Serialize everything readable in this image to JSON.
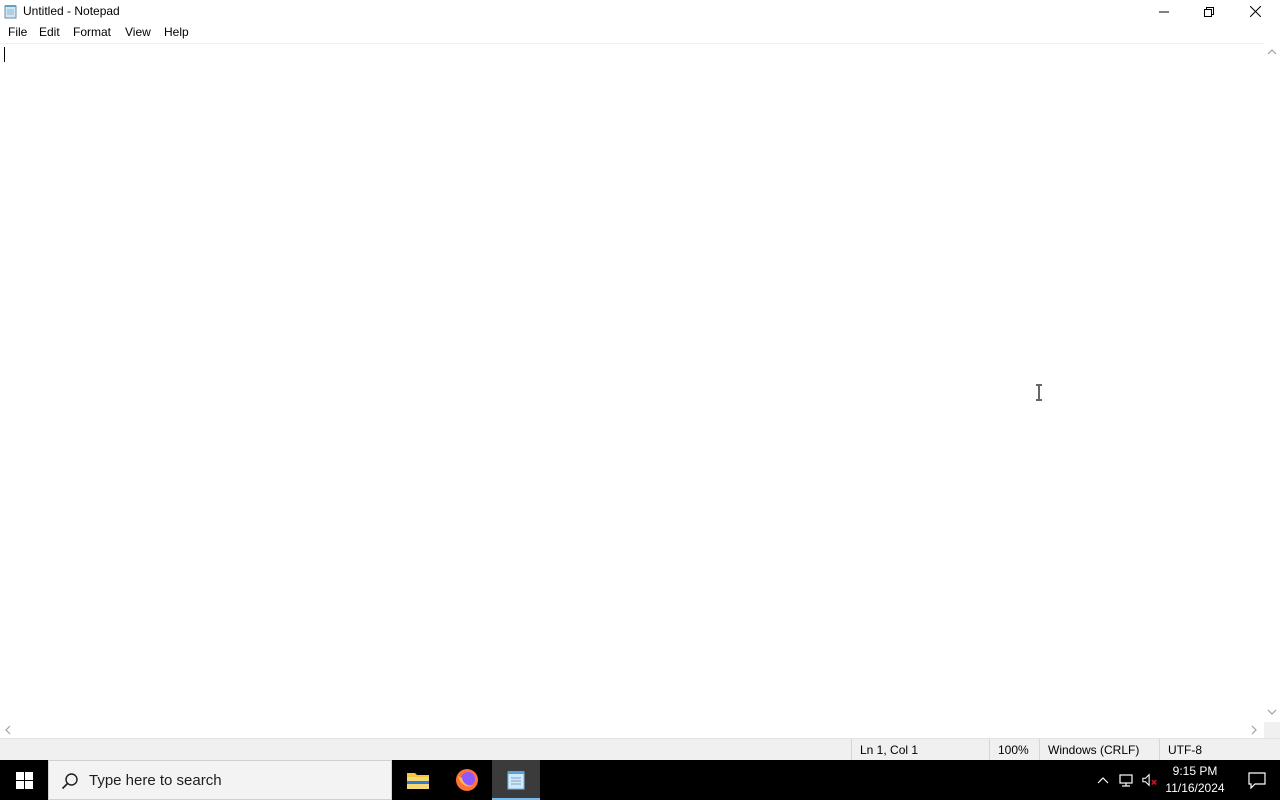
{
  "window": {
    "title": "Untitled - Notepad",
    "icon": "notepad-icon"
  },
  "menu": {
    "items": [
      "File",
      "Edit",
      "Format",
      "View",
      "Help"
    ]
  },
  "editor": {
    "content": ""
  },
  "status": {
    "position": "Ln 1, Col 1",
    "zoom": "100%",
    "line_ending": "Windows (CRLF)",
    "encoding": "UTF-8"
  },
  "taskbar": {
    "search_placeholder": "Type here to search",
    "apps": [
      "file-explorer-icon",
      "firefox-icon",
      "notepad-icon"
    ],
    "active_app": "notepad-icon",
    "time": "9:15 PM",
    "date": "11/16/2024",
    "accent_color": "#76b9ed"
  }
}
